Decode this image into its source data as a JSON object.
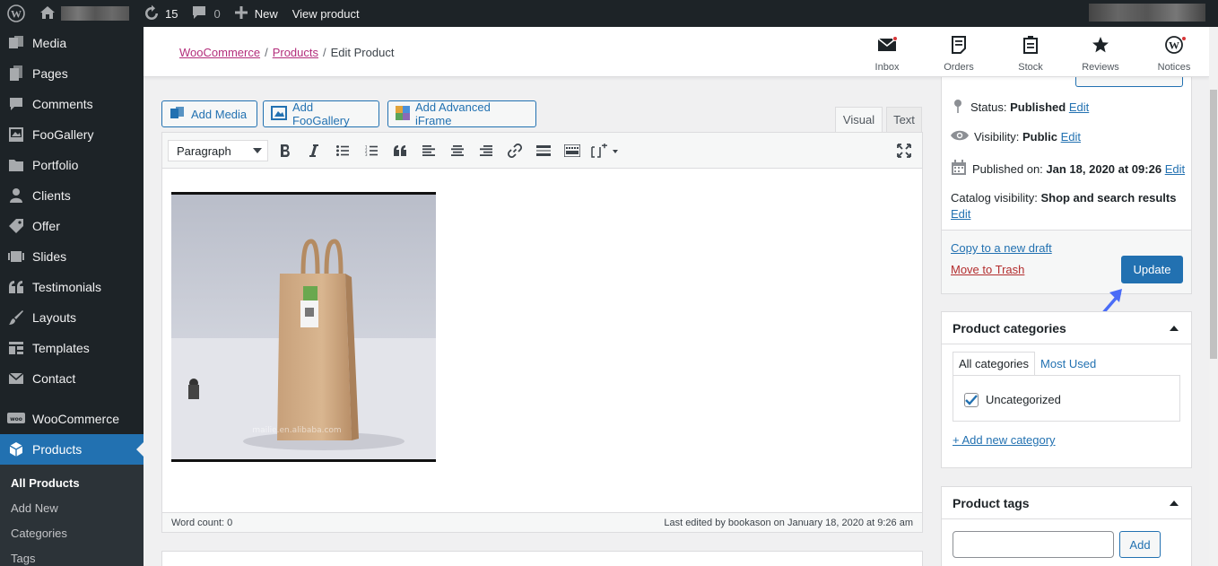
{
  "adminbar": {
    "updates_count": "15",
    "comments_count": "0",
    "new_label": "New",
    "view_label": "View product"
  },
  "sidebar": {
    "items": [
      {
        "label": "Media",
        "icon": "media-icon"
      },
      {
        "label": "Pages",
        "icon": "pages-icon"
      },
      {
        "label": "Comments",
        "icon": "comments-icon"
      },
      {
        "label": "FooGallery",
        "icon": "gallery-icon"
      },
      {
        "label": "Portfolio",
        "icon": "folder-icon"
      },
      {
        "label": "Clients",
        "icon": "person-icon"
      },
      {
        "label": "Offer",
        "icon": "tag-icon"
      },
      {
        "label": "Slides",
        "icon": "slides-icon"
      },
      {
        "label": "Testimonials",
        "icon": "quote-icon"
      },
      {
        "label": "Layouts",
        "icon": "brush-icon"
      },
      {
        "label": "Templates",
        "icon": "templates-icon"
      },
      {
        "label": "Contact",
        "icon": "mail-icon"
      },
      {
        "label": "WooCommerce",
        "icon": "woo-icon"
      },
      {
        "label": "Products",
        "icon": "cube-icon"
      }
    ],
    "submenu": [
      "All Products",
      "Add New",
      "Categories",
      "Tags"
    ]
  },
  "breadcrumb": {
    "woocommerce": "WooCommerce",
    "products": "Products",
    "current": "Edit Product",
    "sep": "/"
  },
  "header_tools": [
    {
      "label": "Inbox",
      "icon": "inbox-icon"
    },
    {
      "label": "Orders",
      "icon": "orders-icon"
    },
    {
      "label": "Stock",
      "icon": "stock-icon"
    },
    {
      "label": "Reviews",
      "icon": "star-icon"
    },
    {
      "label": "Notices",
      "icon": "wordpress-icon"
    }
  ],
  "editor": {
    "add_media": "Add Media",
    "add_foogallery": "Add FooGallery",
    "add_iframe": "Add Advanced iFrame",
    "tab_visual": "Visual",
    "tab_text": "Text",
    "format": "Paragraph",
    "image_watermark": "mailie.en.alibaba.com",
    "word_count": "Word count: 0",
    "last_edited": "Last edited by bookason on January 18, 2020 at 9:26 am"
  },
  "publish": {
    "status_label": "Status:",
    "status_value": "Published",
    "visibility_label": "Visibility:",
    "visibility_value": "Public",
    "published_label": "Published on:",
    "published_value": "Jan 18, 2020 at 09:26",
    "catalog_label": "Catalog visibility:",
    "catalog_value": "Shop and search results",
    "edit": "Edit",
    "copy_draft": "Copy to a new draft",
    "trash": "Move to Trash",
    "update": "Update"
  },
  "categories": {
    "title": "Product categories",
    "tab_all": "All categories",
    "tab_most_used": "Most Used",
    "item": "Uncategorized",
    "item_checked": true,
    "add_new": "+ Add new category"
  },
  "tags": {
    "title": "Product tags",
    "add": "Add"
  },
  "colors": {
    "accent": "#2271b1",
    "adminbar": "#1d2327",
    "woo_link": "#b32d7b",
    "trash": "#b32d2e"
  }
}
